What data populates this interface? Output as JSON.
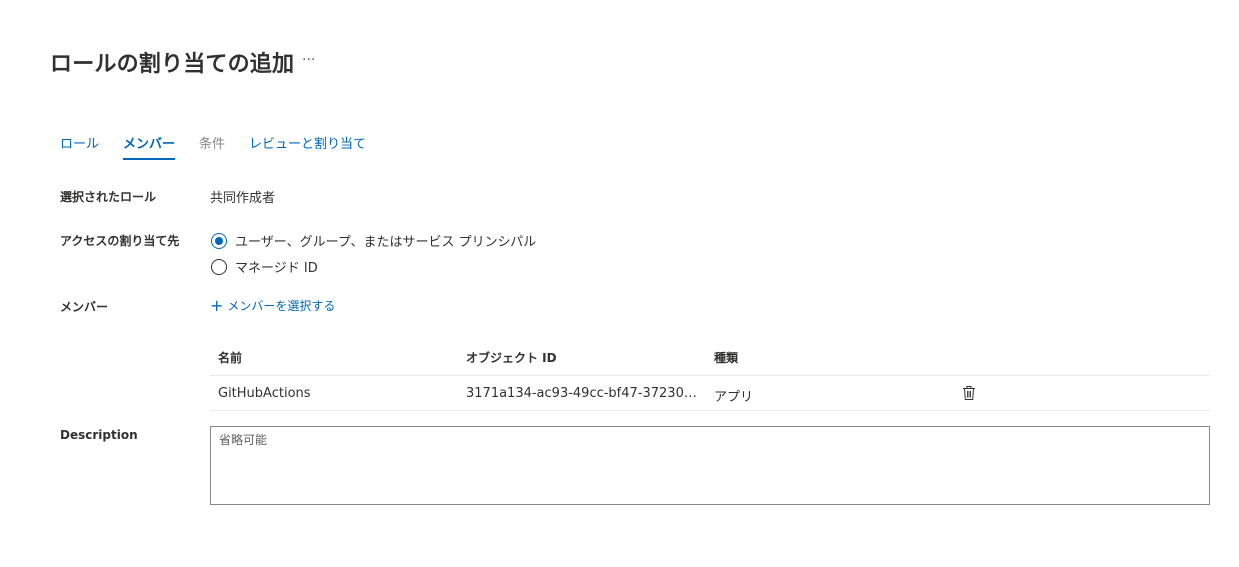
{
  "header": {
    "title": "ロールの割り当ての追加",
    "more_label": "···"
  },
  "tabs": [
    {
      "label": "ロール",
      "state": "normal"
    },
    {
      "label": "メンバー",
      "state": "active"
    },
    {
      "label": "条件",
      "state": "disabled"
    },
    {
      "label": "レビューと割り当て",
      "state": "normal"
    }
  ],
  "form": {
    "selected_role_label": "選択されたロール",
    "selected_role_value": "共同作成者",
    "assign_access_label": "アクセスの割り当て先",
    "assign_options": [
      {
        "label": "ユーザー、グループ、またはサービス プリンシパル",
        "checked": true
      },
      {
        "label": "マネージド ID",
        "checked": false
      }
    ],
    "members_label": "メンバー",
    "select_members_link": "メンバーを選択する",
    "description_label": "Description",
    "description_placeholder": "省略可能",
    "description_value": ""
  },
  "members_table": {
    "columns": [
      "名前",
      "オブジェクト ID",
      "種類"
    ],
    "rows": [
      {
        "name": "GitHubActions",
        "object_id": "3171a134-ac93-49cc-bf47-37230c…",
        "type": "アプリ",
        "action_icon": "trash-icon"
      }
    ]
  },
  "colors": {
    "accent": "#0067b8",
    "text": "#323130",
    "disabled": "#8a8886"
  }
}
